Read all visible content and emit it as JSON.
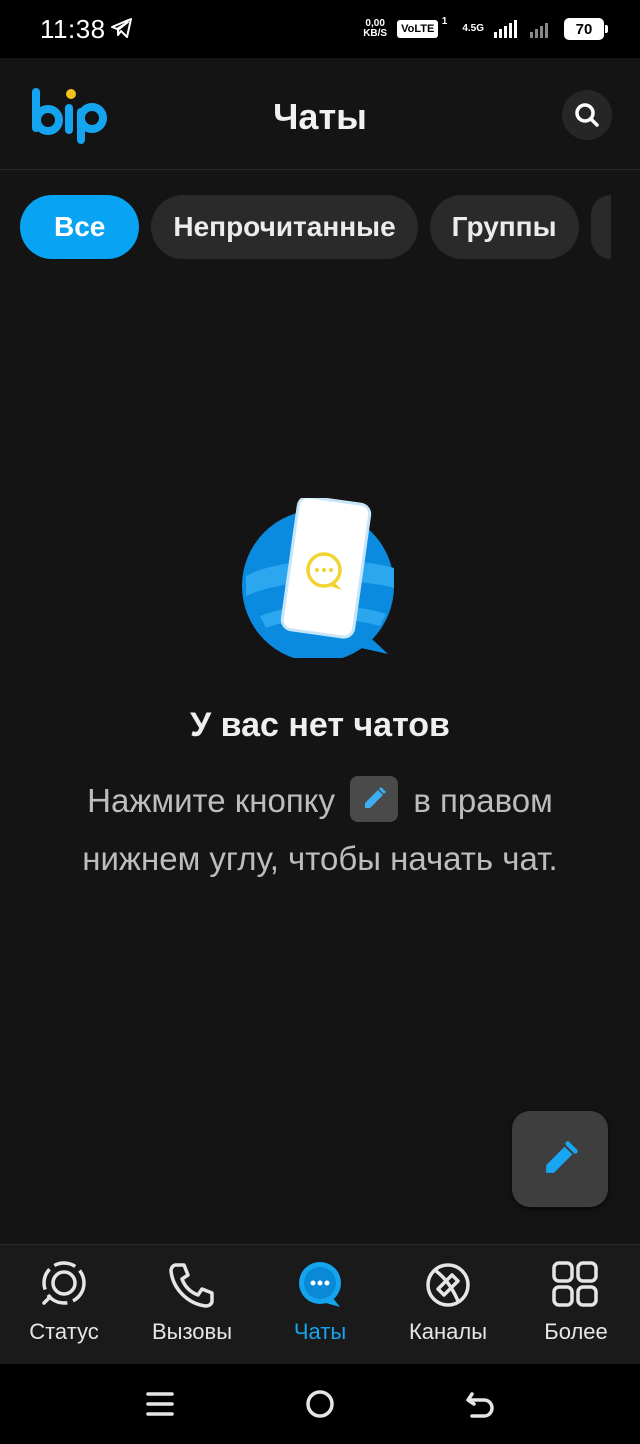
{
  "status_bar": {
    "time": "11:38",
    "net_speed_value": "0,00",
    "net_speed_unit": "KB/S",
    "volte": "VoLTE",
    "sim": "1",
    "network": "4.5G",
    "battery": "70"
  },
  "header": {
    "logo": "bip",
    "title": "Чаты",
    "search_icon": "search-icon"
  },
  "filters": [
    {
      "label": "Все",
      "active": true
    },
    {
      "label": "Непрочитанные",
      "active": false
    },
    {
      "label": "Группы",
      "active": false
    }
  ],
  "empty_state": {
    "title": "У вас нет чатов",
    "hint_part1": "Нажмите кнопку",
    "hint_part2": "в правом нижнем углу, чтобы начать чат."
  },
  "fab": {
    "icon": "pencil-icon"
  },
  "bottom_nav": [
    {
      "label": "Статус",
      "icon": "status-icon",
      "active": false
    },
    {
      "label": "Вызовы",
      "icon": "phone-icon",
      "active": false
    },
    {
      "label": "Чаты",
      "icon": "chat-bubble-icon",
      "active": true
    },
    {
      "label": "Каналы",
      "icon": "channels-icon",
      "active": false
    },
    {
      "label": "Более",
      "icon": "grid-icon",
      "active": false
    }
  ],
  "colors": {
    "accent": "#08a3f2",
    "background": "#141414",
    "chip_bg": "#2a2a2a",
    "illustration_yellow": "#f2d32f"
  }
}
